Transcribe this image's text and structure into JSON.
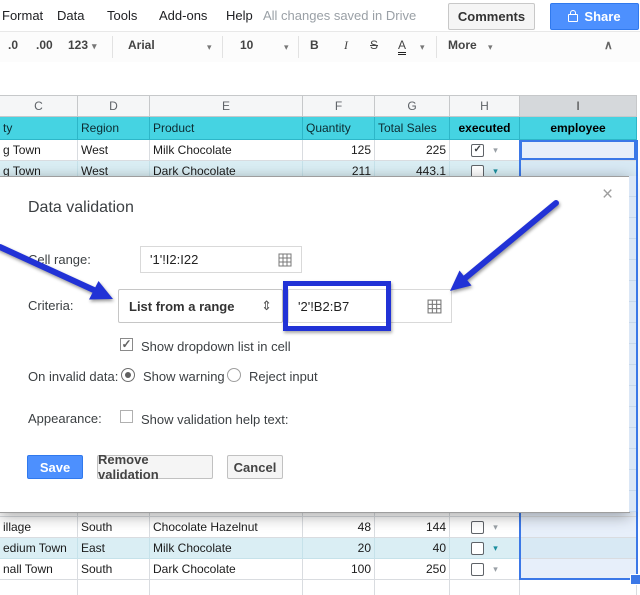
{
  "menu": {
    "items": [
      "Format",
      "Data",
      "Tools",
      "Add-ons",
      "Help"
    ],
    "status": "All changes saved in Drive",
    "comments": "Comments",
    "share": "Share"
  },
  "toolbar": {
    "decrease_decimal": ".0",
    "increase_decimal": ".00",
    "more_formats": "123",
    "font": "Arial",
    "font_size": "10",
    "bold": "B",
    "italic": "I",
    "strikethrough": "S",
    "text_color": "A",
    "more": "More"
  },
  "glyphs": {
    "dropdown": "▾",
    "check": "✓",
    "updown": "⇕",
    "collapse": "∧",
    "close": "×"
  },
  "sheet": {
    "column_letters": [
      "C",
      "D",
      "E",
      "F",
      "G",
      "H",
      "I"
    ],
    "header": {
      "city": "ty",
      "region": "Region",
      "product": "Product",
      "quantity": "Quantity",
      "total_sales": "Total Sales",
      "executed": "executed",
      "employee": "employee"
    },
    "rows": [
      {
        "city": "g Town",
        "region": "West",
        "product": "Milk Chocolate",
        "quantity": "125",
        "total_sales": "225",
        "executed": "checked"
      },
      {
        "city": "g Town",
        "region": "West",
        "product": "Dark Chocolate",
        "quantity": "211",
        "total_sales": "443.1",
        "executed": "unchecked"
      },
      {
        "city": "illage",
        "region": "South",
        "product": "Chocolate Hazelnut",
        "quantity": "48",
        "total_sales": "144",
        "executed": "unchecked"
      },
      {
        "city": "edium Town",
        "region": "East",
        "product": "Milk Chocolate",
        "quantity": "20",
        "total_sales": "40",
        "executed": "unchecked"
      },
      {
        "city": "nall Town",
        "region": "South",
        "product": "Dark Chocolate",
        "quantity": "100",
        "total_sales": "250",
        "executed": "unchecked"
      }
    ]
  },
  "dialog": {
    "title": "Data validation",
    "cell_range_label": "Cell range:",
    "cell_range_value": "'1'!I2:I22",
    "criteria_label": "Criteria:",
    "criteria_type": "List from a range",
    "criteria_value": "'2'!B2:B7",
    "show_dropdown_label": "Show dropdown list in cell",
    "show_dropdown_checked": true,
    "invalid_label": "On invalid data:",
    "warning_label": "Show warning",
    "warning_selected": true,
    "reject_label": "Reject input",
    "reject_selected": false,
    "appearance_label": "Appearance:",
    "help_text_label": "Show validation help text:",
    "help_text_checked": false,
    "save": "Save",
    "remove": "Remove validation",
    "cancel": "Cancel"
  },
  "colors": {
    "accent_blue": "#4d90fe",
    "selection_blue": "#3b78e7",
    "annotation_blue": "#2132d6",
    "header_cyan": "#45d3e2",
    "band_blue": "#daeef4",
    "teal_arrow": "#1b8e9e"
  }
}
